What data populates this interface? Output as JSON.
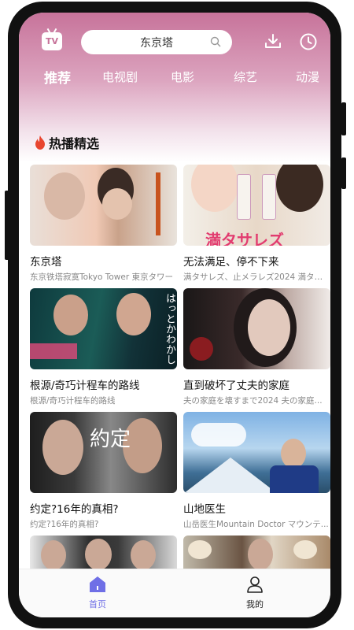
{
  "search": {
    "value": "东京塔"
  },
  "tabs": [
    {
      "label": "推荐",
      "active": true
    },
    {
      "label": "电视剧",
      "active": false
    },
    {
      "label": "电影",
      "active": false
    },
    {
      "label": "综艺",
      "active": false
    },
    {
      "label": "动漫",
      "active": false
    }
  ],
  "section": {
    "title": "热播精选",
    "icon": "flame-icon"
  },
  "cards": [
    {
      "title": "东京塔",
      "subtitle": "东京铁塔寂寞Tokyo Tower 東京タワー"
    },
    {
      "title": "无法满足、停不下来",
      "subtitle": "满タサレズ、止メラレズ2024 満タサ..."
    },
    {
      "title": "根源/奇巧计程车的路线",
      "subtitle": "根源/奇巧计程车的路线"
    },
    {
      "title": "直到破坏了丈夫的家庭",
      "subtitle": "夫の家庭を壊すまで2024 夫の家庭..."
    },
    {
      "title": "约定?16年的真相?",
      "subtitle": "约定?16年的真相?"
    },
    {
      "title": "山地医生",
      "subtitle": "山岳医生Mountain Doctor マウンテ..."
    },
    {
      "title": "",
      "subtitle": ""
    },
    {
      "title": "",
      "subtitle": ""
    }
  ],
  "posters": {
    "p2_text": "満タサレズ",
    "p3_text": "はっとかわかし",
    "p5_text": "約定"
  },
  "bottom_nav": [
    {
      "label": "首页",
      "active": true,
      "icon": "home-icon"
    },
    {
      "label": "我的",
      "active": false,
      "icon": "user-icon"
    }
  ],
  "colors": {
    "accent": "#6f6fe6",
    "header_top": "#c7739a"
  }
}
